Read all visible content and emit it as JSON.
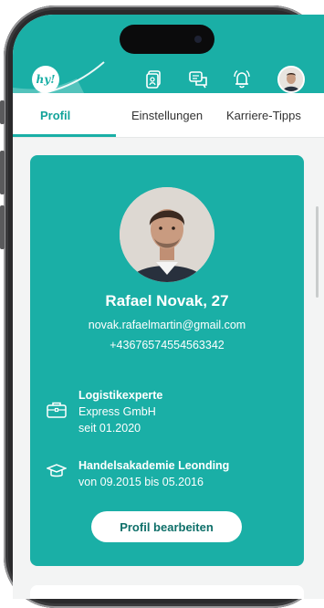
{
  "header": {
    "logo_text": "hy!",
    "icons": [
      "documents-icon",
      "chat-icon",
      "bell-icon"
    ],
    "accent": "#1aafa6"
  },
  "tabs": [
    {
      "label": "Profil",
      "active": true
    },
    {
      "label": "Einstellungen",
      "active": false
    },
    {
      "label": "Karriere-Tipps",
      "active": false
    }
  ],
  "profile": {
    "name": "Rafael Novak, 27",
    "email": "novak.rafaelmartin@gmail.com",
    "phone": "+4367657455 4563342",
    "job": {
      "title": "Logistikexperte",
      "company": "Express GmbH",
      "since": "seit 01.2020"
    },
    "education": {
      "school": "Handelsakademie Leonding",
      "period": "von 09.2015 bis 05.2016"
    },
    "edit_label": "Profil bearbeiten"
  }
}
